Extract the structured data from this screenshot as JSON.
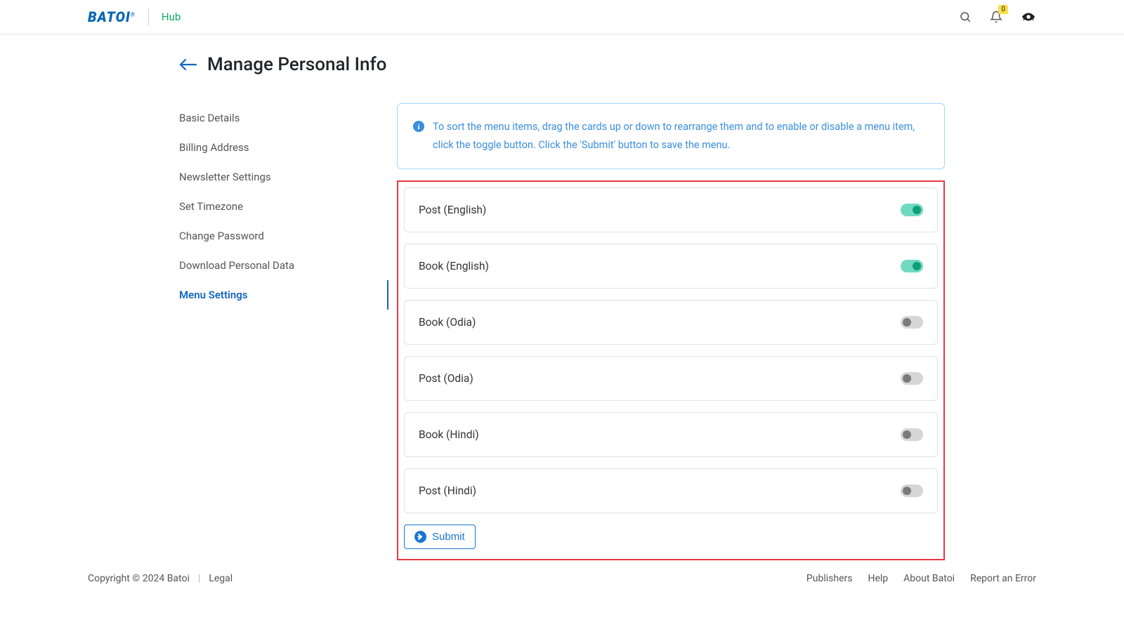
{
  "header": {
    "logo_text": "BATOI",
    "logo_suffix": "®",
    "hub_label": "Hub",
    "notification_count": "0"
  },
  "page": {
    "title": "Manage Personal Info"
  },
  "sidebar": {
    "items": [
      {
        "label": "Basic Details",
        "active": false
      },
      {
        "label": "Billing Address",
        "active": false
      },
      {
        "label": "Newsletter Settings",
        "active": false
      },
      {
        "label": "Set Timezone",
        "active": false
      },
      {
        "label": "Change Password",
        "active": false
      },
      {
        "label": "Download Personal Data",
        "active": false
      },
      {
        "label": "Menu Settings",
        "active": true
      }
    ]
  },
  "alert": {
    "text": "To sort the menu items, drag the cards up or down to rearrange them and to enable or disable a menu item, click the toggle button. Click the 'Submit' button to save the menu."
  },
  "menu_items": [
    {
      "label": "Post (English)",
      "enabled": true
    },
    {
      "label": "Book (English)",
      "enabled": true
    },
    {
      "label": "Book (Odia)",
      "enabled": false
    },
    {
      "label": "Post (Odia)",
      "enabled": false
    },
    {
      "label": "Book (Hindi)",
      "enabled": false
    },
    {
      "label": "Post (Hindi)",
      "enabled": false
    }
  ],
  "buttons": {
    "submit": "Submit"
  },
  "footer": {
    "copyright": "Copyright © 2024 Batoi",
    "legal": "Legal",
    "links": [
      "Publishers",
      "Help",
      "About Batoi",
      "Report an Error"
    ]
  }
}
